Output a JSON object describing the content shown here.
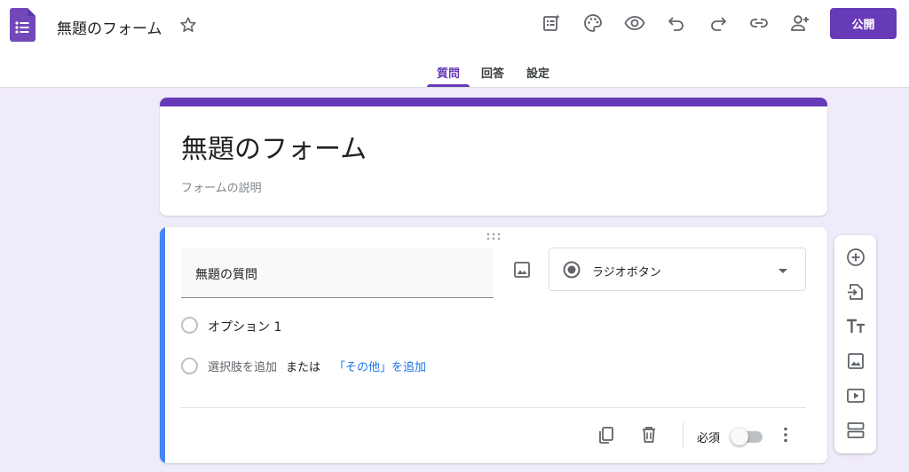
{
  "header": {
    "doc_title": "無題のフォーム",
    "publish_label": "公開"
  },
  "tabs": [
    {
      "label": "質問",
      "active": true
    },
    {
      "label": "回答",
      "active": false
    },
    {
      "label": "設定",
      "active": false
    }
  ],
  "form": {
    "title": "無題のフォーム",
    "description_placeholder": "フォームの説明"
  },
  "question": {
    "title": "無題の質問",
    "type_label": "ラジオボタン",
    "options": [
      "オプション 1"
    ],
    "add_option_label": "選択肢を追加",
    "or_label": "または",
    "add_other_label": "「その他」を追加",
    "required_label": "必須",
    "required": false
  },
  "colors": {
    "accent": "#673ab7",
    "background": "#f0ebf8",
    "active_question": "#4285f4",
    "link": "#1a73e8"
  },
  "icons": {
    "toolbar": [
      "customize-theme-icon",
      "palette-icon",
      "preview-eye-icon",
      "undo-icon",
      "redo-icon",
      "link-icon",
      "add-collaborator-icon"
    ],
    "side_toolbar": [
      "add-question-icon",
      "import-questions-icon",
      "add-title-icon",
      "add-image-icon",
      "add-video-icon",
      "add-section-icon"
    ]
  }
}
